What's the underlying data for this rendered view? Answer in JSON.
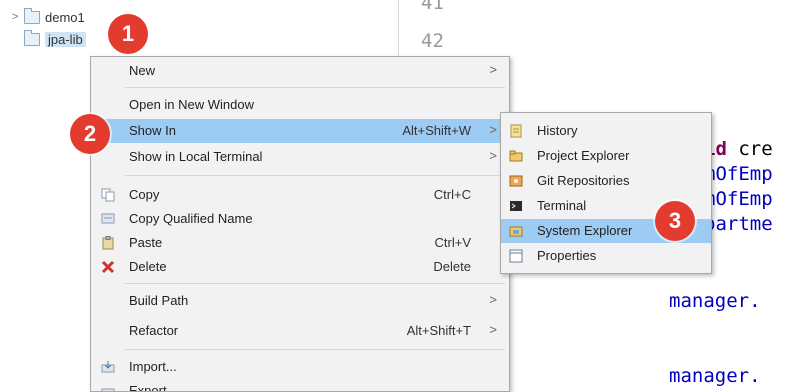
{
  "explorer": {
    "items": [
      {
        "label": "demo1",
        "expanded": false
      },
      {
        "label": "jpa-lib",
        "selected": true
      }
    ]
  },
  "editor": {
    "line_numbers": [
      "41",
      "42"
    ],
    "lines": [
      {
        "kw": "id",
        "rest": " cre"
      },
      {
        "rest": "mOfEmp"
      },
      {
        "rest": "mOfEmp"
      },
      {
        "rest": "partme"
      },
      {
        "rest": "manager."
      },
      {
        "rest": "manager."
      }
    ],
    "stray_kw": "i"
  },
  "context_menu": {
    "items": [
      {
        "label": "New",
        "accel": "",
        "submenu": true
      },
      {
        "label": "Open in New Window",
        "accel": "",
        "submenu": false
      },
      {
        "label": "Show In",
        "accel": "Alt+Shift+W",
        "submenu": true,
        "highlighted": true
      },
      {
        "label": "Show in Local Terminal",
        "accel": "",
        "submenu": true
      },
      {
        "label": "Copy",
        "accel": "Ctrl+C",
        "icon": "copy-icon"
      },
      {
        "label": "Copy Qualified Name",
        "accel": "",
        "icon": "copy-qualified-icon"
      },
      {
        "label": "Paste",
        "accel": "Ctrl+V",
        "icon": "paste-icon"
      },
      {
        "label": "Delete",
        "accel": "Delete",
        "icon": "delete-icon"
      },
      {
        "label": "Build Path",
        "accel": "",
        "submenu": true
      },
      {
        "label": "Refactor",
        "accel": "Alt+Shift+T",
        "submenu": true
      },
      {
        "label": "Import...",
        "accel": "",
        "icon": "import-icon"
      },
      {
        "label": "Export...",
        "accel": "",
        "icon": "export-icon"
      }
    ]
  },
  "show_in_submenu": {
    "items": [
      {
        "label": "History",
        "icon": "history-icon"
      },
      {
        "label": "Project Explorer",
        "icon": "project-explorer-icon"
      },
      {
        "label": "Git Repositories",
        "icon": "git-repositories-icon"
      },
      {
        "label": "Terminal",
        "icon": "terminal-icon"
      },
      {
        "label": "System Explorer",
        "icon": "system-explorer-icon",
        "highlighted": true
      },
      {
        "label": "Properties",
        "icon": "properties-icon"
      }
    ]
  },
  "arrow_glyph": ">",
  "badges": [
    "1",
    "2",
    "3"
  ],
  "colors": {
    "menu_bg": "#f2f2f2",
    "highlight": "#9ccbf3",
    "badge": "#e33b2e",
    "keyword": "#7f0055",
    "field": "#0000c0"
  }
}
